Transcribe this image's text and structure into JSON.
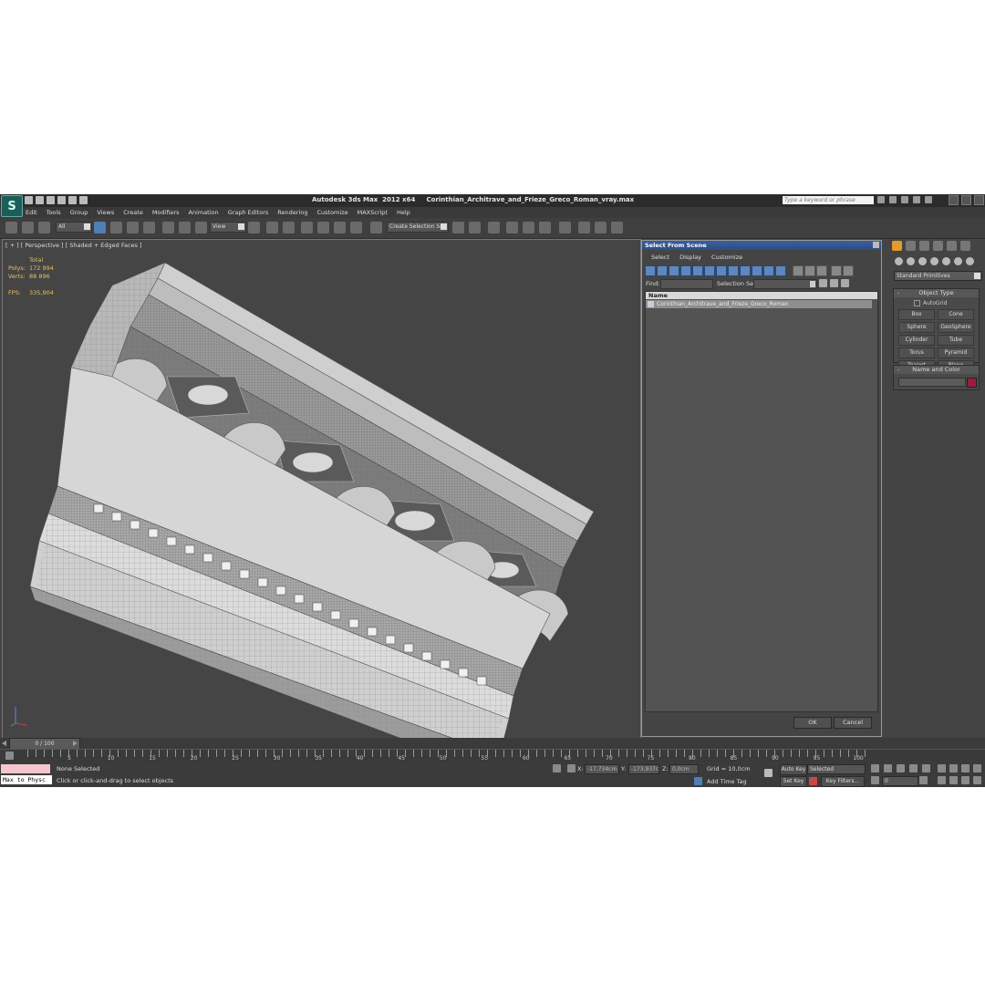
{
  "app": {
    "title": "Autodesk 3ds Max  2012 x64     Corinthian_Architrave_and_Frieze_Greco_Roman_vray.max",
    "search_placeholder": "Type a keyword or phrase",
    "logo_glyph": "S"
  },
  "menu": [
    "Edit",
    "Tools",
    "Group",
    "Views",
    "Create",
    "Modifiers",
    "Animation",
    "Graph Editors",
    "Rendering",
    "Customize",
    "MAXScript",
    "Help"
  ],
  "toolbar": {
    "selection_filter": "All",
    "ref_coord": "View",
    "named_selection": "Create Selection Se"
  },
  "viewport": {
    "label": "[ + ] [ Perspective ] [ Shaded + Edged Faces ]",
    "stats": {
      "total_label": "Total",
      "polys_label": "Polys:",
      "polys_value": "172 994",
      "verts_label": "Verts:",
      "verts_value": "88 896",
      "fps_label": "FPS:",
      "fps_value": "335,904"
    }
  },
  "dialog": {
    "title": "Select From Scene",
    "menu": [
      "Select",
      "Display",
      "Customize"
    ],
    "find_label": "Find:",
    "selset_label": "Selection Set:",
    "column_name": "Name",
    "items": [
      {
        "name": "Corinthian_Architrave_and_Frieze_Greco_Roman"
      }
    ],
    "ok_label": "OK",
    "cancel_label": "Cancel"
  },
  "command_panel": {
    "category": "Standard Primitives",
    "object_type_title": "Object Type",
    "autogrid_label": "AutoGrid",
    "buttons": [
      "Box",
      "Cone",
      "Sphere",
      "GeoSphere",
      "Cylinder",
      "Tube",
      "Torus",
      "Pyramid",
      "Teapot",
      "Plane"
    ],
    "name_color_title": "Name and Color",
    "object_color": "#9b1b3c"
  },
  "timeline": {
    "slider_label": "0 / 100",
    "ticks": [
      "5",
      "10",
      "15",
      "20",
      "25",
      "30",
      "35",
      "40",
      "45",
      "50",
      "55",
      "60",
      "65",
      "70",
      "75",
      "80",
      "85",
      "90",
      "95",
      "100"
    ]
  },
  "status": {
    "maxscript_text": "Max to Physc",
    "selection": "None Selected",
    "prompt": "Click or click-and-drag to select objects",
    "x_label": "X:",
    "x_value": "-17,734cm",
    "y_label": "Y:",
    "y_value": "-173,937c",
    "z_label": "Z:",
    "z_value": "0,0cm",
    "grid": "Grid = 10,0cm",
    "add_time_tag": "Add Time Tag",
    "auto_key": "Auto Key",
    "set_key": "Set Key",
    "key_mode": "Selected",
    "key_filters": "Key Filters...",
    "frame_value": "0"
  }
}
